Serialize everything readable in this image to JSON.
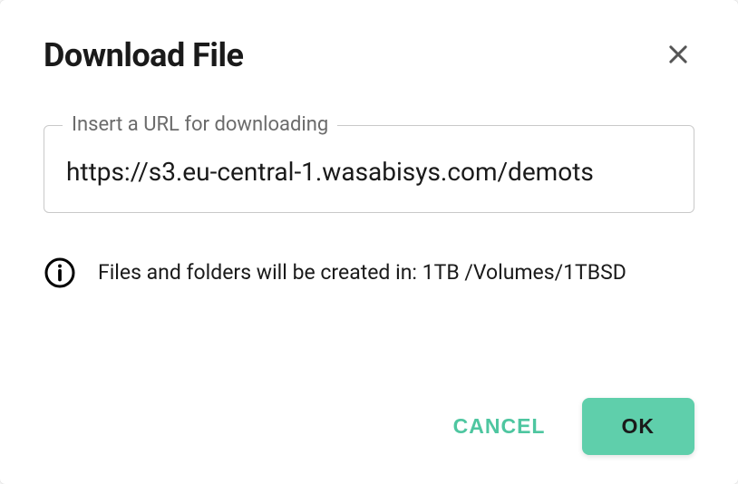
{
  "dialog": {
    "title": "Download File",
    "url_field": {
      "label": "Insert a URL for downloading",
      "value": "https://s3.eu-central-1.wasabisys.com/demots"
    },
    "info_text": "Files and folders will be created in: 1TB /Volumes/1TBSD",
    "actions": {
      "cancel": "CANCEL",
      "ok": "OK"
    }
  }
}
